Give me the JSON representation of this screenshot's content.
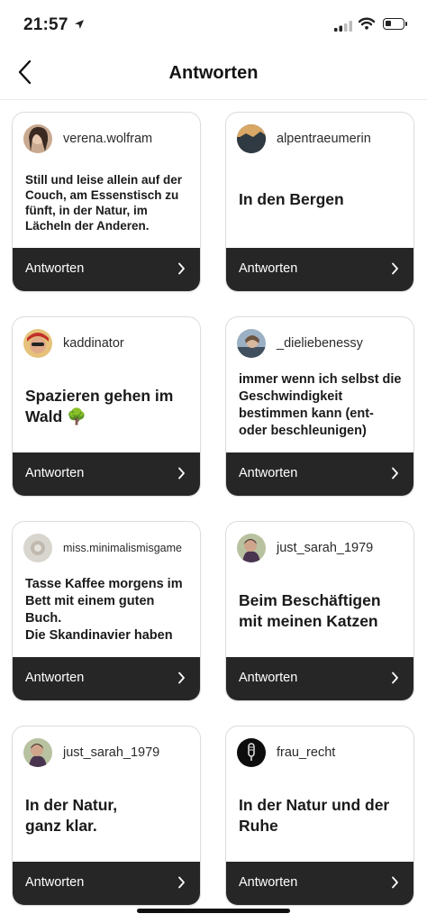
{
  "status_bar": {
    "time": "21:57",
    "location_icon": "location-arrow-icon",
    "signal_icon": "cellular-signal-icon",
    "wifi_icon": "wifi-icon",
    "battery_icon": "battery-icon",
    "battery_level": 0.35
  },
  "header": {
    "title": "Antworten",
    "back_icon": "chevron-left-icon"
  },
  "cards": [
    {
      "username": "verena.wolfram",
      "answer": "Still und leise allein auf der Couch, am Essenstisch zu fünft, in der Natur, im Lächeln der Anderen.",
      "reply_label": "Antworten"
    },
    {
      "username": "alpentraeumerin",
      "answer": "In den Bergen",
      "reply_label": "Antworten"
    },
    {
      "username": "kaddinator",
      "answer": "Spazieren gehen im Wald 🌳",
      "reply_label": "Antworten"
    },
    {
      "username": "_dieliebenessy",
      "answer": "immer wenn ich selbst die Geschwindigkeit bestimmen kann (ent- oder beschleunigen)",
      "reply_label": "Antworten"
    },
    {
      "username": "miss.minimalismisgame",
      "answer": "Tasse Kaffee morgens im Bett mit einem guten Buch.\nDie Skandinavier haben",
      "reply_label": "Antworten"
    },
    {
      "username": "just_sarah_1979",
      "answer": "Beim Beschäftigen mit meinen Katzen",
      "reply_label": "Antworten"
    },
    {
      "username": "just_sarah_1979",
      "answer": "In der Natur, ganz klar.",
      "reply_label": "Antworten"
    },
    {
      "username": "frau_recht",
      "answer": "In der Natur und der Ruhe",
      "reply_label": "Antworten"
    }
  ],
  "colors": {
    "reply_bar": "#262626",
    "card_border": "#dcdcdc",
    "text": "#1a1a1a"
  }
}
